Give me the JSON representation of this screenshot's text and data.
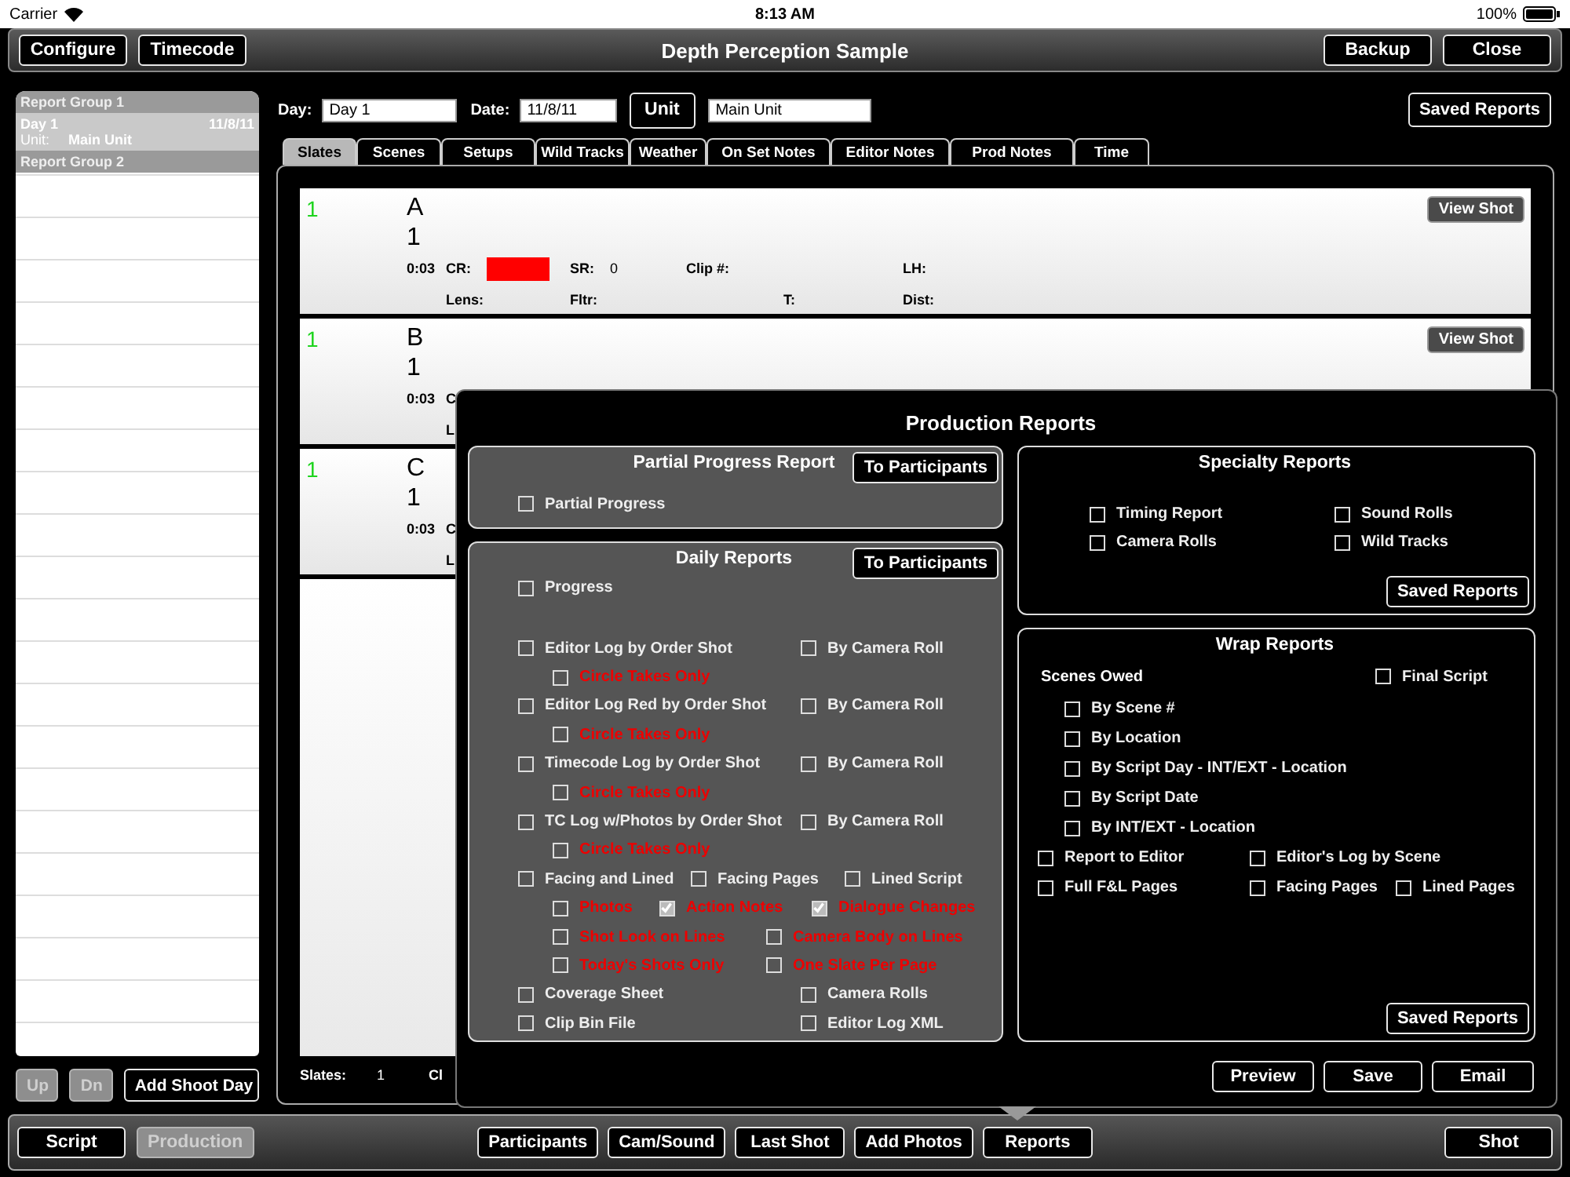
{
  "status_bar": {
    "carrier": "Carrier",
    "time": "8:13 AM",
    "battery": "100%"
  },
  "toolbar": {
    "left_buttons": [
      "Configure",
      "Timecode"
    ],
    "title": "Depth Perception Sample",
    "right_buttons": [
      "Backup",
      "Close"
    ]
  },
  "sidebar": {
    "groups": [
      {
        "title": "Report Group 1",
        "items": [
          {
            "day": "Day 1",
            "date": "11/8/11",
            "unit_label": "Unit:",
            "unit": "Main Unit",
            "selected": true
          }
        ]
      },
      {
        "title": "Report Group 2"
      }
    ],
    "buttons": [
      {
        "label": "Up",
        "disabled": true
      },
      {
        "label": "Dn",
        "disabled": true
      },
      {
        "label": "Add Shoot Day",
        "disabled": false
      }
    ]
  },
  "header": {
    "day_label": "Day:",
    "day": "Day 1",
    "date_label": "Date:",
    "date": "11/8/11",
    "unit_button": "Unit",
    "unit": "Main Unit",
    "saved_reports": "Saved Reports"
  },
  "tabs": [
    {
      "label": "Slates",
      "selected": true
    },
    {
      "label": "Scenes",
      "selected": false
    },
    {
      "label": "Setups",
      "selected": false
    },
    {
      "label": "Wild Tracks",
      "selected": false
    },
    {
      "label": "Weather",
      "selected": false
    },
    {
      "label": "On Set Notes",
      "selected": false
    },
    {
      "label": "Editor Notes",
      "selected": false
    },
    {
      "label": "Prod Notes",
      "selected": false
    },
    {
      "label": "Time",
      "selected": false
    }
  ],
  "slates": [
    {
      "number": "1",
      "scene": "A",
      "take": "1",
      "time": "0:03",
      "view_shot": "View Shot",
      "row_1": [
        {
          "kind": "swatch",
          "label": "CR:"
        },
        {
          "kind": "text",
          "label": "SR:",
          "value": "0"
        },
        {
          "kind": "text",
          "label": "Clip #:"
        },
        {
          "kind": "text",
          "label": "LH:"
        }
      ],
      "row_2": [
        {
          "kind": "text",
          "label": "Lens:"
        },
        {
          "kind": "text",
          "label": "Fltr:"
        },
        {
          "kind": "text",
          "label": "T:"
        },
        {
          "kind": "text",
          "label": "Dist:"
        }
      ]
    },
    {
      "number": "1",
      "scene": "B",
      "take": "1",
      "time": "0:03",
      "view_shot": "View Shot",
      "row_1": [
        {
          "kind": "text",
          "label": "C"
        }
      ],
      "row_2": [
        {
          "kind": "text",
          "label": "L"
        }
      ]
    },
    {
      "number": "1",
      "scene": "C",
      "take": "1",
      "time": "0:03",
      "row_1": [
        {
          "kind": "text",
          "label": "C"
        }
      ],
      "row_2": [
        {
          "kind": "text",
          "label": "L"
        }
      ]
    }
  ],
  "slates_footer": {
    "label": "Slates:",
    "count": "1",
    "column_3": "Cl"
  },
  "production_reports": {
    "title": "Production Reports",
    "partial": {
      "title": "Partial Progress Report",
      "button": "To Participants",
      "items": [
        {
          "label": "Partial Progress",
          "checked": false
        }
      ]
    },
    "daily": {
      "title": "Daily Reports",
      "button": "To Participants",
      "progress": {
        "label": "Progress",
        "checked": false
      },
      "rows": [
        {
          "items": [
            {
              "kind": "main",
              "label": "Editor Log by Order Shot",
              "checked": false
            },
            {
              "kind": "main",
              "label": "By Camera Roll",
              "checked": false
            }
          ]
        },
        {
          "items": [
            {
              "kind": "sub",
              "label": "Circle Takes Only",
              "checked": false
            }
          ]
        },
        {
          "items": [
            {
              "kind": "main",
              "label": "Editor Log Red by Order Shot",
              "checked": false
            },
            {
              "kind": "main",
              "label": "By Camera Roll",
              "checked": false
            }
          ]
        },
        {
          "items": [
            {
              "kind": "sub",
              "label": "Circle Takes Only",
              "checked": false
            }
          ]
        },
        {
          "items": [
            {
              "kind": "main",
              "label": "Timecode Log by Order Shot",
              "checked": false
            },
            {
              "kind": "main",
              "label": "By Camera Roll",
              "checked": false
            }
          ]
        },
        {
          "items": [
            {
              "kind": "sub",
              "label": "Circle Takes Only",
              "checked": false
            }
          ]
        },
        {
          "items": [
            {
              "kind": "main",
              "label": "TC Log w/Photos by Order Shot",
              "checked": false
            },
            {
              "kind": "main",
              "label": "By Camera Roll",
              "checked": false
            }
          ]
        },
        {
          "items": [
            {
              "kind": "sub",
              "label": "Circle Takes Only",
              "checked": false
            }
          ]
        },
        {
          "items": [
            {
              "kind": "main",
              "label": "Facing and Lined",
              "checked": false
            },
            {
              "kind": "main",
              "label": "Facing Pages",
              "checked": false
            },
            {
              "kind": "main",
              "label": "Lined Script",
              "checked": false
            }
          ]
        },
        {
          "items": [
            {
              "kind": "sub",
              "label": "Photos",
              "checked": false
            },
            {
              "kind": "sub",
              "label": "Action Notes",
              "checked": true
            },
            {
              "kind": "sub",
              "label": "Dialogue Changes",
              "checked": true
            }
          ]
        },
        {
          "items": [
            {
              "kind": "sub",
              "label": "Shot Look on Lines",
              "checked": false
            },
            {
              "kind": "sub",
              "label": "Camera Body on Lines",
              "checked": false
            }
          ]
        },
        {
          "items": [
            {
              "kind": "sub",
              "label": "Today's Shots Only",
              "checked": false
            },
            {
              "kind": "sub",
              "label": "One Slate Per Page",
              "checked": false
            }
          ]
        },
        {
          "items": [
            {
              "kind": "main",
              "label": "Coverage Sheet",
              "checked": false
            },
            {
              "kind": "main",
              "label": "Camera Rolls",
              "checked": false
            }
          ]
        },
        {
          "items": [
            {
              "kind": "main",
              "label": "Clip Bin File",
              "checked": false
            },
            {
              "kind": "main",
              "label": "Editor Log XML",
              "checked": false
            }
          ]
        }
      ]
    },
    "specialty": {
      "title": "Specialty Reports",
      "items": [
        {
          "label": "Timing Report",
          "checked": false
        },
        {
          "label": "Sound Rolls",
          "checked": false
        },
        {
          "label": "Camera Rolls",
          "checked": false
        },
        {
          "label": "Wild Tracks",
          "checked": false
        }
      ],
      "button": "Saved Reports"
    },
    "wrap": {
      "title": "Wrap Reports",
      "scenes_owed_label": "Scenes Owed",
      "final_script": {
        "label": "Final Script",
        "checked": false
      },
      "scenes_owed": [
        {
          "label": "By Scene #",
          "checked": false
        },
        {
          "label": "By Location",
          "checked": false
        },
        {
          "label": "By Script Day - INT/EXT - Location",
          "checked": false
        },
        {
          "label": "By Script Date",
          "checked": false
        },
        {
          "label": "By INT/EXT - Location",
          "checked": false
        }
      ],
      "rows": [
        {
          "items": [
            {
              "label": "Report to Editor",
              "checked": false
            },
            {
              "label": "Editor's Log by Scene",
              "checked": false
            }
          ]
        },
        {
          "items": [
            {
              "label": "Full F&L Pages",
              "checked": false
            },
            {
              "label": "Facing Pages",
              "checked": false
            },
            {
              "label": "Lined Pages",
              "checked": false
            }
          ]
        }
      ],
      "button": "Saved Reports"
    },
    "buttons": [
      "Preview",
      "Save",
      "Email"
    ]
  },
  "bottom_toolbar": {
    "left": [
      {
        "label": "Script",
        "selected": false
      },
      {
        "label": "Production",
        "selected": true
      }
    ],
    "center": [
      {
        "label": "Participants",
        "selected": false
      },
      {
        "label": "Cam/Sound",
        "selected": false
      },
      {
        "label": "Last Shot",
        "selected": false
      },
      {
        "label": "Add Photos",
        "selected": false
      },
      {
        "label": "Reports",
        "selected": false
      }
    ],
    "right": [
      {
        "label": "Shot",
        "selected": false
      }
    ]
  }
}
